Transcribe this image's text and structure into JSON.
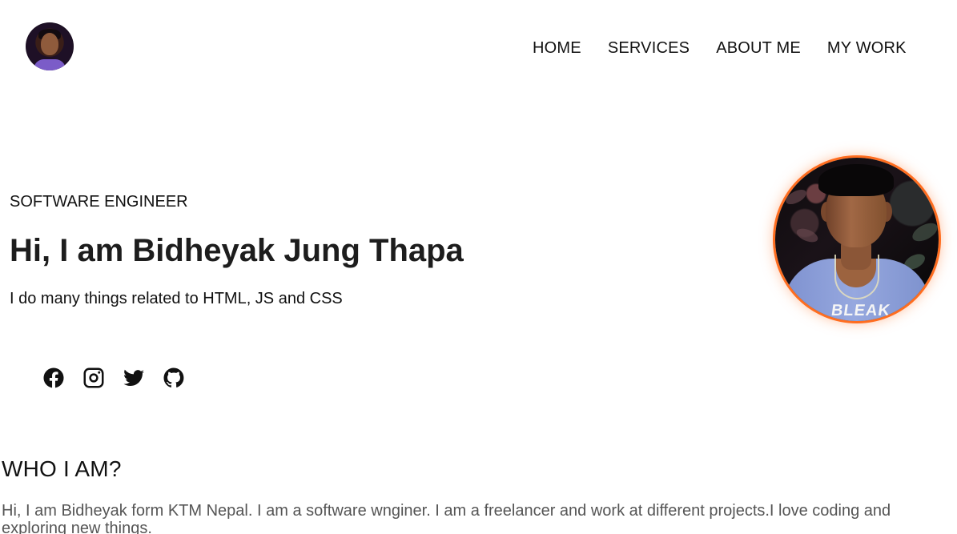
{
  "header": {
    "nav": [
      {
        "label": "HOME"
      },
      {
        "label": "SERVICES"
      },
      {
        "label": "ABOUT ME"
      },
      {
        "label": "MY WORK"
      }
    ]
  },
  "hero": {
    "eyebrow": "SOFTWARE ENGINEER",
    "title": "Hi, I am Bidheyak Jung Thapa",
    "subtitle": "I do many things related to HTML, JS and CSS",
    "portrait_shirt_text": "BLEAK",
    "social_icons": [
      "facebook-icon",
      "instagram-icon",
      "twitter-icon",
      "github-icon"
    ]
  },
  "about": {
    "title": "WHO I AM?",
    "text": "Hi, I am Bidheyak form KTM Nepal. I am a software wnginer. I am a freelancer and work at different projects.I love coding and exploring new things."
  },
  "colors": {
    "background": "#ffffff",
    "primary_text": "#111111",
    "secondary_text": "#555555",
    "accent": "#ff6d1f"
  }
}
